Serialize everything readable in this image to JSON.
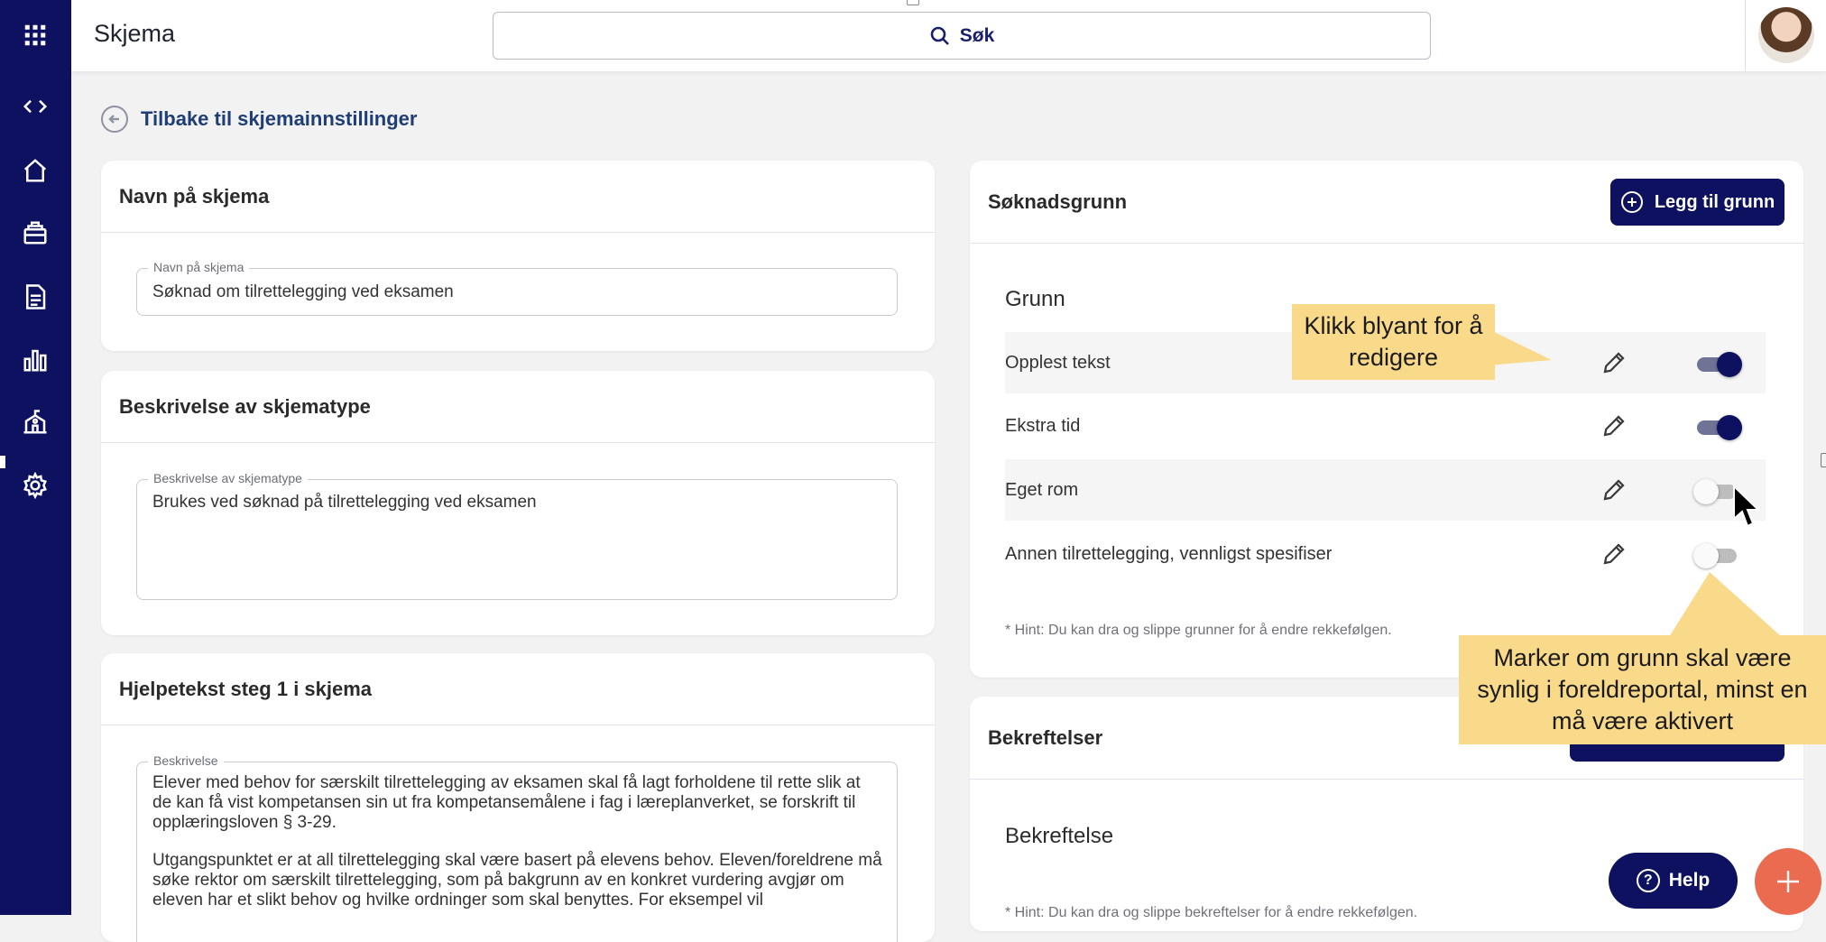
{
  "app": {
    "title": "Skjema"
  },
  "search": {
    "label": "Søk"
  },
  "sidebar": {
    "items": [
      {
        "icon": "apps-grid-icon"
      },
      {
        "icon": "code-icon"
      },
      {
        "icon": "home-icon"
      },
      {
        "icon": "school-bag-icon"
      },
      {
        "icon": "document-icon"
      },
      {
        "icon": "bar-chart-icon"
      },
      {
        "icon": "school-building-icon"
      },
      {
        "icon": "gear-icon"
      }
    ]
  },
  "back_link": {
    "label": "Tilbake til skjemainnstillinger"
  },
  "name_card": {
    "title": "Navn på skjema",
    "field_label": "Navn på skjema",
    "field_value": "Søknad om tilrettelegging ved eksamen"
  },
  "desc_card": {
    "title": "Beskrivelse av skjematype",
    "field_label": "Beskrivelse av skjematype",
    "field_value": "Brukes ved søknad på tilrettelegging ved eksamen"
  },
  "help_card": {
    "title": "Hjelpetekst steg 1 i skjema",
    "field_label": "Beskrivelse",
    "para1": "Elever med behov for særskilt tilrettelegging av eksamen skal få lagt forholdene til rette slik at de kan få vist kompetansen sin ut fra kompetansemålene i fag i læreplanverket, se forskrift til opplæringsloven § 3-29.",
    "para2": "Utgangspunktet er at all tilrettelegging skal være basert på elevens behov. Eleven/foreldrene må søke rektor om særskilt tilrettelegging, som på bakgrunn av en konkret vurdering avgjør om eleven har et slikt behov og hvilke ordninger som skal benyttes. For eksempel vil"
  },
  "reasons_card": {
    "title": "Søknadsgrunn",
    "add_button": "Legg til grunn",
    "column_title": "Grunn",
    "rows": [
      {
        "label": "Opplest tekst",
        "enabled": true
      },
      {
        "label": "Ekstra tid",
        "enabled": true
      },
      {
        "label": "Eget rom",
        "enabled": false
      },
      {
        "label": "Annen tilrettelegging, vennligst spesifiser",
        "enabled": false
      }
    ],
    "hint": "* Hint: Du kan dra og slippe grunner for å endre rekkefølgen."
  },
  "confirm_card": {
    "title": "Bekreftelser",
    "column_title": "Bekreftelse",
    "hint": "* Hint: Du kan dra og slippe bekreftelser for å endre rekkefølgen."
  },
  "callouts": {
    "edit_hint": "Klikk blyant for å redigere",
    "toggle_hint": "Marker om grunn skal være synlig i foreldreportal, minst en må være aktivert"
  },
  "help_button": {
    "label": "Help"
  },
  "colors": {
    "navy": "#0d1160",
    "accent": "#ea6b50",
    "callout": "#f9d98a"
  }
}
